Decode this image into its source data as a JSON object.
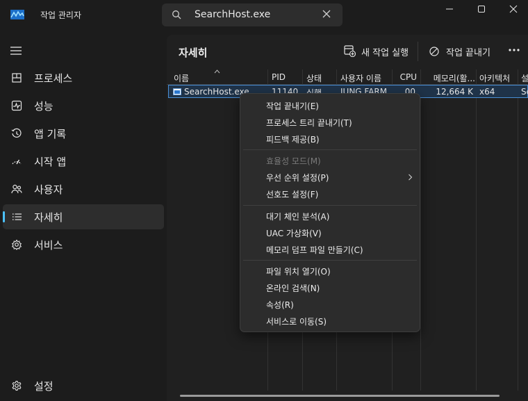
{
  "titlebar": {
    "app_title": "작업 관리자",
    "search_value": "SearchHost.exe"
  },
  "sidebar": {
    "items": [
      {
        "label": "프로세스",
        "icon": "processes-icon"
      },
      {
        "label": "성능",
        "icon": "performance-icon"
      },
      {
        "label": "앱 기록",
        "icon": "app-history-icon"
      },
      {
        "label": "시작 앱",
        "icon": "startup-apps-icon"
      },
      {
        "label": "사용자",
        "icon": "users-icon"
      },
      {
        "label": "자세히",
        "icon": "details-icon",
        "active": true
      },
      {
        "label": "서비스",
        "icon": "services-icon"
      }
    ],
    "settings_label": "설정"
  },
  "main": {
    "title": "자세히",
    "run_new_task": "새 작업 실행",
    "end_task": "작업 끝내기"
  },
  "table": {
    "columns": [
      "이름",
      "PID",
      "상태",
      "사용자 이름",
      "CPU",
      "메모리(활...",
      "아키텍처",
      "설"
    ],
    "rows": [
      {
        "name": "SearchHost.exe",
        "pid": "11140",
        "status": "실행",
        "user": "JUNG FARM",
        "cpu": "00",
        "memory": "12,664 K",
        "arch": "x64",
        "desc": "Se"
      }
    ]
  },
  "context_menu": {
    "groups": [
      [
        "작업 끝내기(E)",
        "프로세스 트리 끝내기(T)",
        "피드백 제공(B)"
      ],
      [
        "효율성 모드(M)",
        "우선 순위 설정(P)",
        "선호도 설정(F)"
      ],
      [
        "대기 체인 분석(A)",
        "UAC 가상화(V)",
        "메모리 덤프 파일 만들기(C)"
      ],
      [
        "파일 위치 열기(O)",
        "온라인 검색(N)",
        "속성(R)",
        "서비스로 이동(S)"
      ]
    ]
  },
  "colors": {
    "accent": "#4cc2ff",
    "selection": "#1f3349",
    "menu_bg": "#2c2c2c"
  }
}
